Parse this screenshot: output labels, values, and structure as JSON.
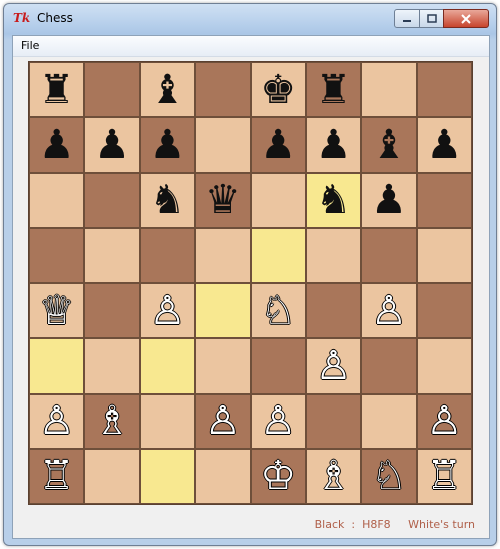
{
  "window": {
    "title": "Chess",
    "icon_text": "Tk",
    "controls": {
      "minimize": "minimize-icon",
      "maximize": "maximize-icon",
      "close": "close-icon"
    }
  },
  "menu": {
    "items": [
      "File"
    ]
  },
  "board": {
    "rows": [
      [
        {
          "p": "♜",
          "c": "b"
        },
        {
          "p": "",
          "c": ""
        },
        {
          "p": "♝",
          "c": "b"
        },
        {
          "p": "",
          "c": ""
        },
        {
          "p": "♚",
          "c": "b"
        },
        {
          "p": "♜",
          "c": "b"
        },
        {
          "p": "",
          "c": ""
        },
        {
          "p": "",
          "c": ""
        }
      ],
      [
        {
          "p": "♟",
          "c": "b"
        },
        {
          "p": "♟",
          "c": "b"
        },
        {
          "p": "♟",
          "c": "b"
        },
        {
          "p": "",
          "c": ""
        },
        {
          "p": "♟",
          "c": "b"
        },
        {
          "p": "♟",
          "c": "b"
        },
        {
          "p": "♝",
          "c": "b"
        },
        {
          "p": "♟",
          "c": "b"
        }
      ],
      [
        {
          "p": "",
          "c": ""
        },
        {
          "p": "",
          "c": ""
        },
        {
          "p": "♞",
          "c": "b"
        },
        {
          "p": "♛",
          "c": "b"
        },
        {
          "p": "",
          "c": ""
        },
        {
          "p": "♞",
          "c": "b"
        },
        {
          "p": "♟",
          "c": "b"
        },
        {
          "p": "",
          "c": ""
        }
      ],
      [
        {
          "p": "",
          "c": ""
        },
        {
          "p": "",
          "c": ""
        },
        {
          "p": "",
          "c": ""
        },
        {
          "p": "",
          "c": ""
        },
        {
          "p": "",
          "c": ""
        },
        {
          "p": "",
          "c": ""
        },
        {
          "p": "",
          "c": ""
        },
        {
          "p": "",
          "c": ""
        }
      ],
      [
        {
          "p": "♕",
          "c": "w"
        },
        {
          "p": "",
          "c": ""
        },
        {
          "p": "♙",
          "c": "w"
        },
        {
          "p": "",
          "c": ""
        },
        {
          "p": "♘",
          "c": "w"
        },
        {
          "p": "",
          "c": ""
        },
        {
          "p": "♙",
          "c": "w"
        },
        {
          "p": "",
          "c": ""
        }
      ],
      [
        {
          "p": "",
          "c": ""
        },
        {
          "p": "",
          "c": ""
        },
        {
          "p": "",
          "c": ""
        },
        {
          "p": "",
          "c": ""
        },
        {
          "p": "",
          "c": ""
        },
        {
          "p": "♙",
          "c": "w"
        },
        {
          "p": "",
          "c": ""
        },
        {
          "p": "",
          "c": ""
        }
      ],
      [
        {
          "p": "♙",
          "c": "w"
        },
        {
          "p": "♗",
          "c": "w"
        },
        {
          "p": "",
          "c": ""
        },
        {
          "p": "♙",
          "c": "w"
        },
        {
          "p": "♙",
          "c": "w"
        },
        {
          "p": "",
          "c": ""
        },
        {
          "p": "",
          "c": ""
        },
        {
          "p": "♙",
          "c": "w"
        }
      ],
      [
        {
          "p": "♖",
          "c": "w"
        },
        {
          "p": "",
          "c": ""
        },
        {
          "p": "",
          "c": ""
        },
        {
          "p": "",
          "c": ""
        },
        {
          "p": "♔",
          "c": "w"
        },
        {
          "p": "♗",
          "c": "w"
        },
        {
          "p": "♘",
          "c": "w"
        },
        {
          "p": "♖",
          "c": "w"
        }
      ]
    ],
    "highlighted": [
      [
        2,
        5
      ],
      [
        3,
        4
      ],
      [
        4,
        3
      ],
      [
        5,
        0
      ],
      [
        5,
        2
      ],
      [
        7,
        2
      ]
    ],
    "colors": {
      "light": "#ebc5a0",
      "dark": "#a9765a",
      "highlight": "#f8e890"
    }
  },
  "status": {
    "last_move": "Black  :  H8F8",
    "turn": "White's turn"
  }
}
